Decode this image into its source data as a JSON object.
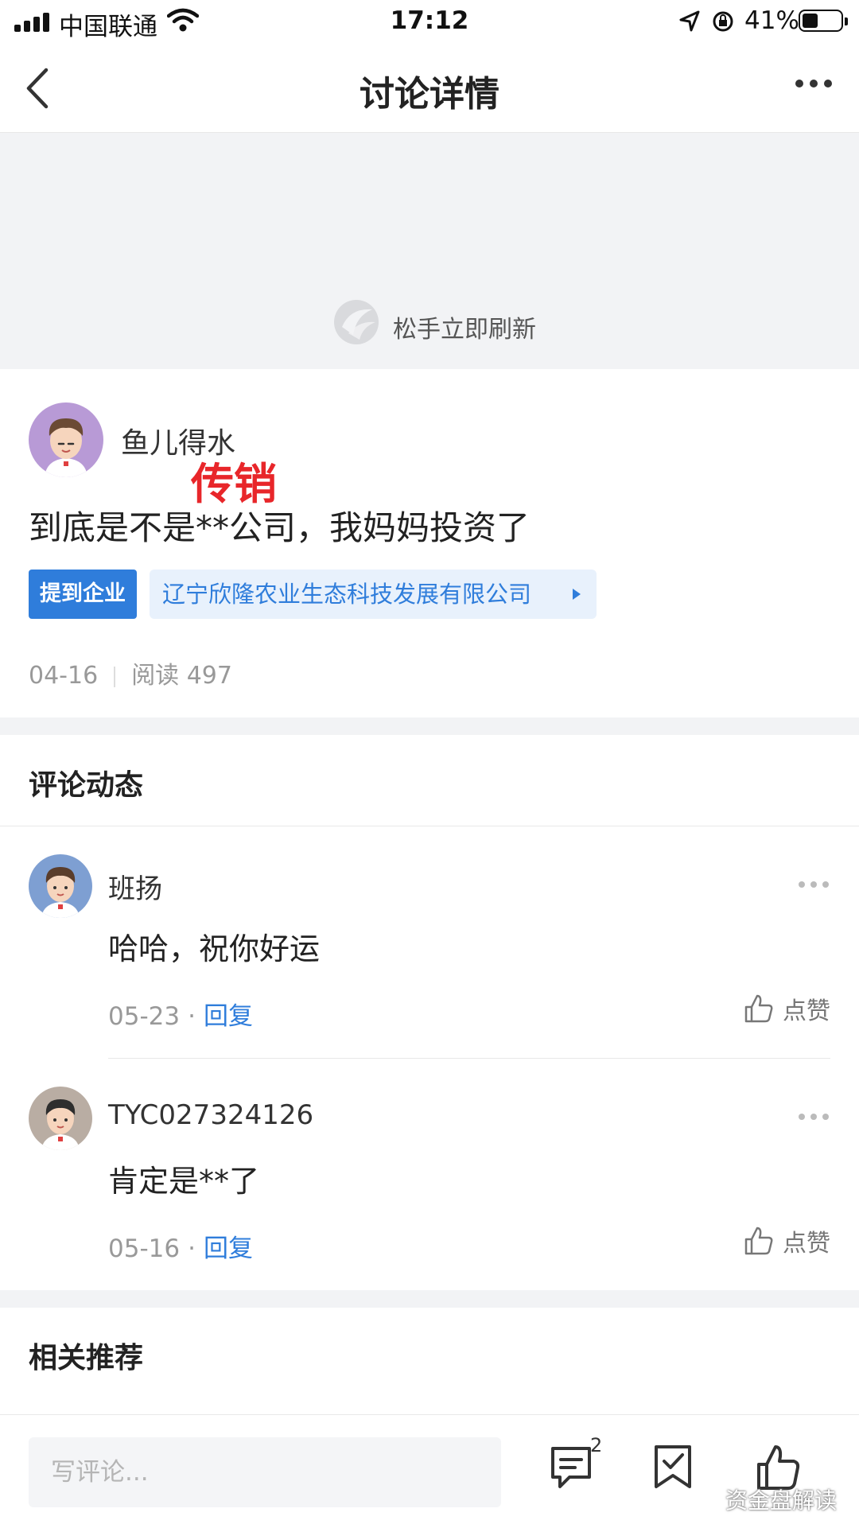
{
  "status_bar": {
    "carrier": "中国联通",
    "time": "17:12",
    "battery": "41%",
    "battery_level": 0.41
  },
  "nav": {
    "title": "讨论详情"
  },
  "refresh": {
    "text": "松手立即刷新"
  },
  "post": {
    "author": "鱼儿得水",
    "annotation": "传销",
    "content": "到底是不是**公司，我妈妈投资了",
    "tag_label": "提到企业",
    "company": "辽宁欣隆农业生态科技发展有限公司",
    "date": "04-16",
    "read_count": "阅读 497"
  },
  "comments_section": {
    "title": "评论动态",
    "items": [
      {
        "author": "班扬",
        "text": "哈哈，祝你好运",
        "date": "05-23",
        "reply_label": "回复",
        "like_label": "点赞"
      },
      {
        "author": "TYC027324126",
        "text": "肯定是**了",
        "date": "05-16",
        "reply_label": "回复",
        "like_label": "点赞"
      }
    ]
  },
  "related": {
    "title": "相关推荐"
  },
  "bottom_bar": {
    "input_placeholder": "写评论...",
    "comment_count": "2",
    "watermark": "资金盘解读"
  },
  "colors": {
    "accent": "#2f7ddb",
    "annotation": "#e8262a",
    "band": "#f2f3f5"
  }
}
